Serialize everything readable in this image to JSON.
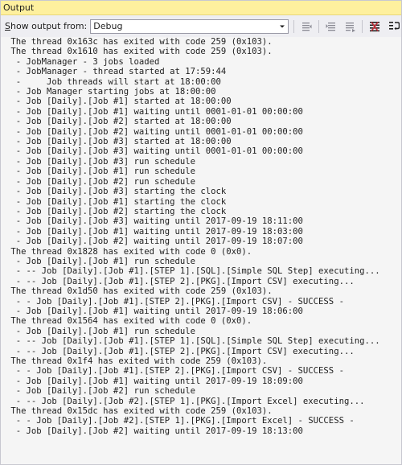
{
  "window": {
    "title": "Output"
  },
  "toolbar": {
    "show_output_label": "Show output from:",
    "source_selected": "Debug",
    "buttons": [
      {
        "icon": "go-to-previous-message-icon"
      },
      {
        "icon": "go-to-next-message-icon"
      },
      {
        "icon": "find-message-icon"
      },
      {
        "icon": "clear-all-icon"
      },
      {
        "icon": "toggle-word-wrap-icon"
      }
    ]
  },
  "output": {
    "lines": [
      " The thread 0x163c has exited with code 259 (0x103).",
      " The thread 0x1610 has exited with code 259 (0x103).",
      "  - JobManager - 3 jobs loaded",
      "  - JobManager - thread started at 17:59:44",
      "  -     Job threads will start at 18:00:00",
      "  - Job Manager starting jobs at 18:00:00",
      "  - Job [Daily].[Job #1] started at 18:00:00",
      "  - Job [Daily].[Job #1] waiting until 0001-01-01 00:00:00",
      "  - Job [Daily].[Job #2] started at 18:00:00",
      "  - Job [Daily].[Job #2] waiting until 0001-01-01 00:00:00",
      "  - Job [Daily].[Job #3] started at 18:00:00",
      "  - Job [Daily].[Job #3] waiting until 0001-01-01 00:00:00",
      "  - Job [Daily].[Job #3] run schedule",
      "  - Job [Daily].[Job #1] run schedule",
      "  - Job [Daily].[Job #2] run schedule",
      "  - Job [Daily].[Job #3] starting the clock",
      "  - Job [Daily].[Job #1] starting the clock",
      "  - Job [Daily].[Job #2] starting the clock",
      "  - Job [Daily].[Job #3] waiting until 2017-09-19 18:11:00",
      "  - Job [Daily].[Job #1] waiting until 2017-09-19 18:03:00",
      "  - Job [Daily].[Job #2] waiting until 2017-09-19 18:07:00",
      " The thread 0x1828 has exited with code 0 (0x0).",
      "  - Job [Daily].[Job #1] run schedule",
      "  - -- Job [Daily].[Job #1].[STEP 1].[SQL].[Simple SQL Step] executing...",
      "  - -- Job [Daily].[Job #1].[STEP 2].[PKG].[Import CSV] executing...",
      " The thread 0x1d50 has exited with code 259 (0x103).",
      "  - - Job [Daily].[Job #1].[STEP 2].[PKG].[Import CSV] - SUCCESS -",
      "  - Job [Daily].[Job #1] waiting until 2017-09-19 18:06:00",
      " The thread 0x1564 has exited with code 0 (0x0).",
      "  - Job [Daily].[Job #1] run schedule",
      "  - -- Job [Daily].[Job #1].[STEP 1].[SQL].[Simple SQL Step] executing...",
      "  - -- Job [Daily].[Job #1].[STEP 2].[PKG].[Import CSV] executing...",
      " The thread 0x1f4 has exited with code 259 (0x103).",
      "  - - Job [Daily].[Job #1].[STEP 2].[PKG].[Import CSV] - SUCCESS -",
      "  - Job [Daily].[Job #1] waiting until 2017-09-19 18:09:00",
      "  - Job [Daily].[Job #2] run schedule",
      "  - -- Job [Daily].[Job #2].[STEP 1].[PKG].[Import Excel] executing...",
      " The thread 0x15dc has exited with code 259 (0x103).",
      "  - - Job [Daily].[Job #2].[STEP 1].[PKG].[Import Excel] - SUCCESS -",
      "  - Job [Daily].[Job #2] waiting until 2017-09-19 18:13:00"
    ]
  }
}
